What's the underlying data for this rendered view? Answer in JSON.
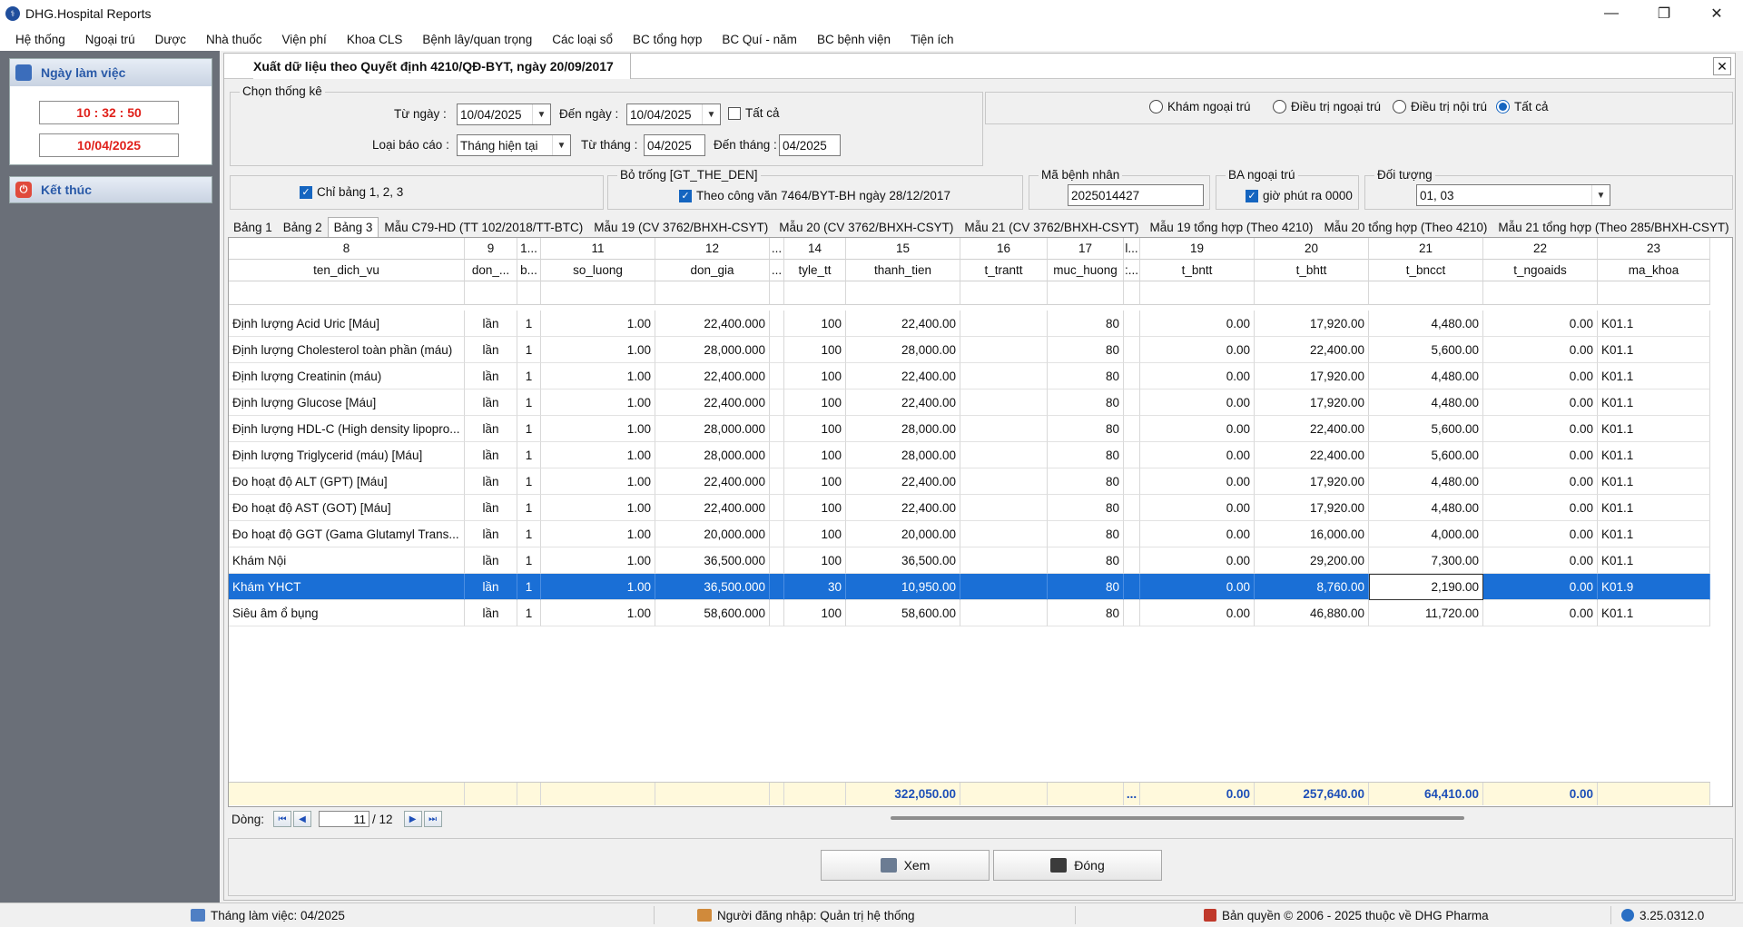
{
  "window": {
    "title": "DHG.Hospital Reports",
    "minimize": "—",
    "restore": "❐",
    "close": "✕"
  },
  "menu": [
    "Hệ thống",
    "Ngoại trú",
    "Dược",
    "Nhà thuốc",
    "Viện phí",
    "Khoa CLS",
    "Bệnh lây/quan trọng",
    "Các loại sổ",
    "BC tổng hợp",
    "BC Quí - năm",
    "BC bệnh viện",
    "Tiện ích"
  ],
  "left_panel": {
    "workday_title": "Ngày làm việc",
    "time": "10 : 32 : 50",
    "date": "10/04/2025",
    "exit_label": "Kết thúc"
  },
  "form": {
    "title": "Xuất dữ liệu theo Quyết định 4210/QĐ-BYT, ngày 20/09/2017",
    "close": "✕",
    "stats_group": "Chọn thống kê",
    "from_date_label": "Từ ngày :",
    "from_date": "10/04/2025",
    "to_date_label": "Đến ngày :",
    "to_date": "10/04/2025",
    "all_label": "Tất cả",
    "report_type_label": "Loại báo cáo :",
    "report_type": "Tháng hiện tại",
    "from_month_label": "Từ tháng :",
    "from_month": "04/2025",
    "to_month_label": "Đến tháng :",
    "to_month": "04/2025",
    "radios": [
      {
        "label": "Khám ngoại trú",
        "checked": false
      },
      {
        "label": "Điều trị ngoại trú",
        "checked": false
      },
      {
        "label": "Điều trị nội trú",
        "checked": false
      },
      {
        "label": "Tất cả",
        "checked": true
      }
    ],
    "only_tables_label": "Chỉ bảng 1, 2, 3",
    "blank_group": "Bỏ trống [GT_THE_DEN]",
    "blank_check_label": "Theo công văn 7464/BYT-BH ngày 28/12/2017",
    "patient_id_group": "Mã bệnh nhân",
    "patient_id": "2025014427",
    "ba_group": "BA ngoại trú",
    "ba_check_label": "giờ phút ra 0000",
    "subject_group": "Đối tượng",
    "subject": "01, 03"
  },
  "tabs": [
    "Bảng 1",
    "Bảng 2",
    "Bảng 3",
    "Mẫu C79-HD (TT 102/2018/TT-BTC)",
    "Mẫu 19 (CV 3762/BHXH-CSYT)",
    "Mẫu 20 (CV 3762/BHXH-CSYT)",
    "Mẫu 21 (CV 3762/BHXH-CSYT)",
    "Mẫu 19 tổng hợp (Theo 4210)",
    "Mẫu 20 tổng hợp (Theo 4210)",
    "Mẫu 21 tổng hợp (Theo 285/BHXH-CSYT)"
  ],
  "active_tab": 2,
  "grid": {
    "col_numbers": [
      "8",
      "9",
      "1...",
      "11",
      "12",
      "...",
      "14",
      "15",
      "16",
      "17",
      "l...",
      "19",
      "20",
      "21",
      "22",
      "23"
    ],
    "col_names": [
      "ten_dich_vu",
      "don_...",
      "b...",
      "so_luong",
      "don_gia",
      "...",
      "tyle_tt",
      "thanh_tien",
      "t_trantt",
      "muc_huong",
      ":...",
      "t_bntt",
      "t_bhtt",
      "t_bncct",
      "t_ngoaids",
      "ma_khoa"
    ],
    "rows": [
      [
        "Định lượng Acid Uric [Máu]",
        "lần",
        "1",
        "1.00",
        "22,400.000",
        "",
        "100",
        "22,400.00",
        "",
        "80",
        "",
        "0.00",
        "17,920.00",
        "4,480.00",
        "0.00",
        "K01.1"
      ],
      [
        "Định lượng Cholesterol toàn phần (máu)",
        "lần",
        "1",
        "1.00",
        "28,000.000",
        "",
        "100",
        "28,000.00",
        "",
        "80",
        "",
        "0.00",
        "22,400.00",
        "5,600.00",
        "0.00",
        "K01.1"
      ],
      [
        "Định lượng Creatinin (máu)",
        "lần",
        "1",
        "1.00",
        "22,400.000",
        "",
        "100",
        "22,400.00",
        "",
        "80",
        "",
        "0.00",
        "17,920.00",
        "4,480.00",
        "0.00",
        "K01.1"
      ],
      [
        "Định lượng Glucose [Máu]",
        "lần",
        "1",
        "1.00",
        "22,400.000",
        "",
        "100",
        "22,400.00",
        "",
        "80",
        "",
        "0.00",
        "17,920.00",
        "4,480.00",
        "0.00",
        "K01.1"
      ],
      [
        "Định lượng HDL-C (High density lipopro...",
        "lần",
        "1",
        "1.00",
        "28,000.000",
        "",
        "100",
        "28,000.00",
        "",
        "80",
        "",
        "0.00",
        "22,400.00",
        "5,600.00",
        "0.00",
        "K01.1"
      ],
      [
        "Định lượng Triglycerid (máu) [Máu]",
        "lần",
        "1",
        "1.00",
        "28,000.000",
        "",
        "100",
        "28,000.00",
        "",
        "80",
        "",
        "0.00",
        "22,400.00",
        "5,600.00",
        "0.00",
        "K01.1"
      ],
      [
        "Đo hoạt độ ALT (GPT) [Máu]",
        "lần",
        "1",
        "1.00",
        "22,400.000",
        "",
        "100",
        "22,400.00",
        "",
        "80",
        "",
        "0.00",
        "17,920.00",
        "4,480.00",
        "0.00",
        "K01.1"
      ],
      [
        "Đo hoạt độ AST (GOT) [Máu]",
        "lần",
        "1",
        "1.00",
        "22,400.000",
        "",
        "100",
        "22,400.00",
        "",
        "80",
        "",
        "0.00",
        "17,920.00",
        "4,480.00",
        "0.00",
        "K01.1"
      ],
      [
        "Đo hoạt độ GGT (Gama Glutamyl Trans...",
        "lần",
        "1",
        "1.00",
        "20,000.000",
        "",
        "100",
        "20,000.00",
        "",
        "80",
        "",
        "0.00",
        "16,000.00",
        "4,000.00",
        "0.00",
        "K01.1"
      ],
      [
        "Khám Nội",
        "lần",
        "1",
        "1.00",
        "36,500.000",
        "",
        "100",
        "36,500.00",
        "",
        "80",
        "",
        "0.00",
        "29,200.00",
        "7,300.00",
        "0.00",
        "K01.1"
      ],
      [
        "Khám YHCT",
        "lần",
        "1",
        "1.00",
        "36,500.000",
        "",
        "30",
        "10,950.00",
        "",
        "80",
        "",
        "0.00",
        "8,760.00",
        "2,190.00",
        "0.00",
        "K01.9"
      ],
      [
        "Siêu âm ổ bụng",
        "lần",
        "1",
        "1.00",
        "58,600.000",
        "",
        "100",
        "58,600.00",
        "",
        "80",
        "",
        "0.00",
        "46,880.00",
        "11,720.00",
        "0.00",
        "K01.1"
      ]
    ],
    "selected_row": 10,
    "totals": [
      "",
      "",
      "",
      "",
      "",
      "",
      "",
      "322,050.00",
      "",
      "",
      "...",
      "0.00",
      "257,640.00",
      "64,410.00",
      "0.00",
      ""
    ]
  },
  "nav": {
    "label": "Dòng:",
    "current": "11",
    "total": "/ 12"
  },
  "buttons": {
    "view": "Xem",
    "close": "Đóng"
  },
  "status": {
    "workmonth": "Tháng làm việc: 04/2025",
    "user": "Người đăng nhập: Quản trị hệ thống",
    "copyright": "Bản quyền © 2006 - 2025 thuộc về DHG Pharma",
    "version": "3.25.0312.0"
  }
}
